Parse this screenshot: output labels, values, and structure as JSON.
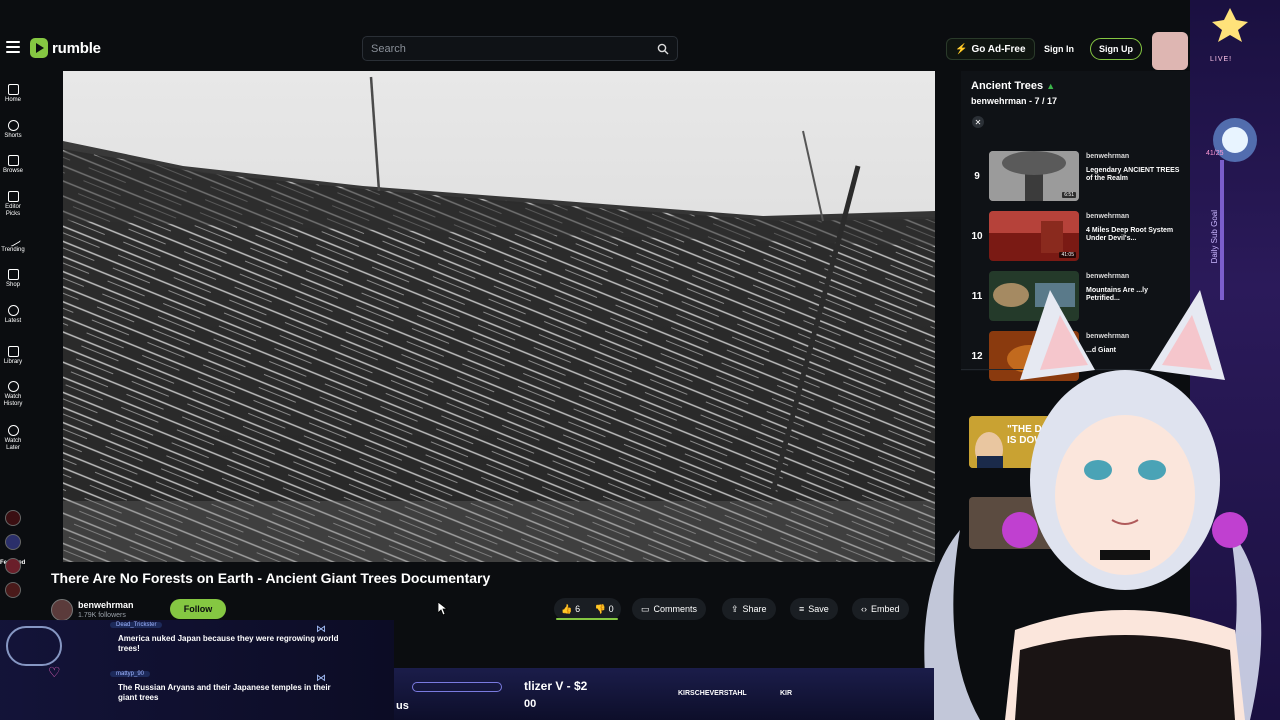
{
  "header": {
    "logo_text": "rumble",
    "search_placeholder": "Search",
    "go_ad_free": "Go Ad-Free",
    "sign_in": "Sign In",
    "sign_up": "Sign Up"
  },
  "sidebar": {
    "items": [
      {
        "label": "Home"
      },
      {
        "label": "Shorts"
      },
      {
        "label": "Browse"
      },
      {
        "label": "Editor Picks"
      },
      {
        "label": "Trending"
      },
      {
        "label": "Shop"
      },
      {
        "label": "Latest"
      },
      {
        "label": "Library"
      },
      {
        "label": "Watch History"
      },
      {
        "label": "Watch Later"
      }
    ],
    "featured_label": "Featured"
  },
  "video": {
    "title": "There Are No Forests on Earth - Ancient Giant Trees Documentary",
    "channel": "benwehrman",
    "followers": "1.79K followers",
    "follow": "Follow",
    "likes": "6",
    "dislikes": "0",
    "actions": {
      "comments": "Comments",
      "share": "Share",
      "save": "Save",
      "embed": "Embed"
    }
  },
  "playlist": {
    "title": "Ancient Trees",
    "owner": "benwehrman",
    "position": "- 7 / 17",
    "items": [
      {
        "num": "9",
        "channel": "benwehrman",
        "title": "Legendary ANCIENT TREES of the Realm",
        "duration": "6:51"
      },
      {
        "num": "10",
        "channel": "benwehrman",
        "title": "4 Miles Deep Root System Under Devil's...",
        "duration": "41:05"
      },
      {
        "num": "11",
        "channel": "benwehrman",
        "title": "Mountains Are ...ly Petrified...",
        "duration": ""
      },
      {
        "num": "12",
        "channel": "benwehrman",
        "title": "...d Giant",
        "duration": ""
      }
    ],
    "rec_thumb_text": "\"THE DEA IS DOW"
  },
  "overlay": {
    "chat": [
      {
        "user": "Dead_Trickster",
        "msg": "America nuked Japan because they were regrowing world trees!"
      },
      {
        "user": "mattyp_90",
        "msg": "The Russian Aryans and their Japanese temples in their giant trees"
      }
    ],
    "ticker_text": "tlizer V - $2",
    "ticker_small": "00",
    "ticker_us": "us",
    "handle_1": "KIRSCHEVERSTAHL",
    "handle_2": "KIR",
    "live_badge": "LIVE!",
    "goal_count": "41/25",
    "goal_label": "Daily Sub Goal"
  }
}
